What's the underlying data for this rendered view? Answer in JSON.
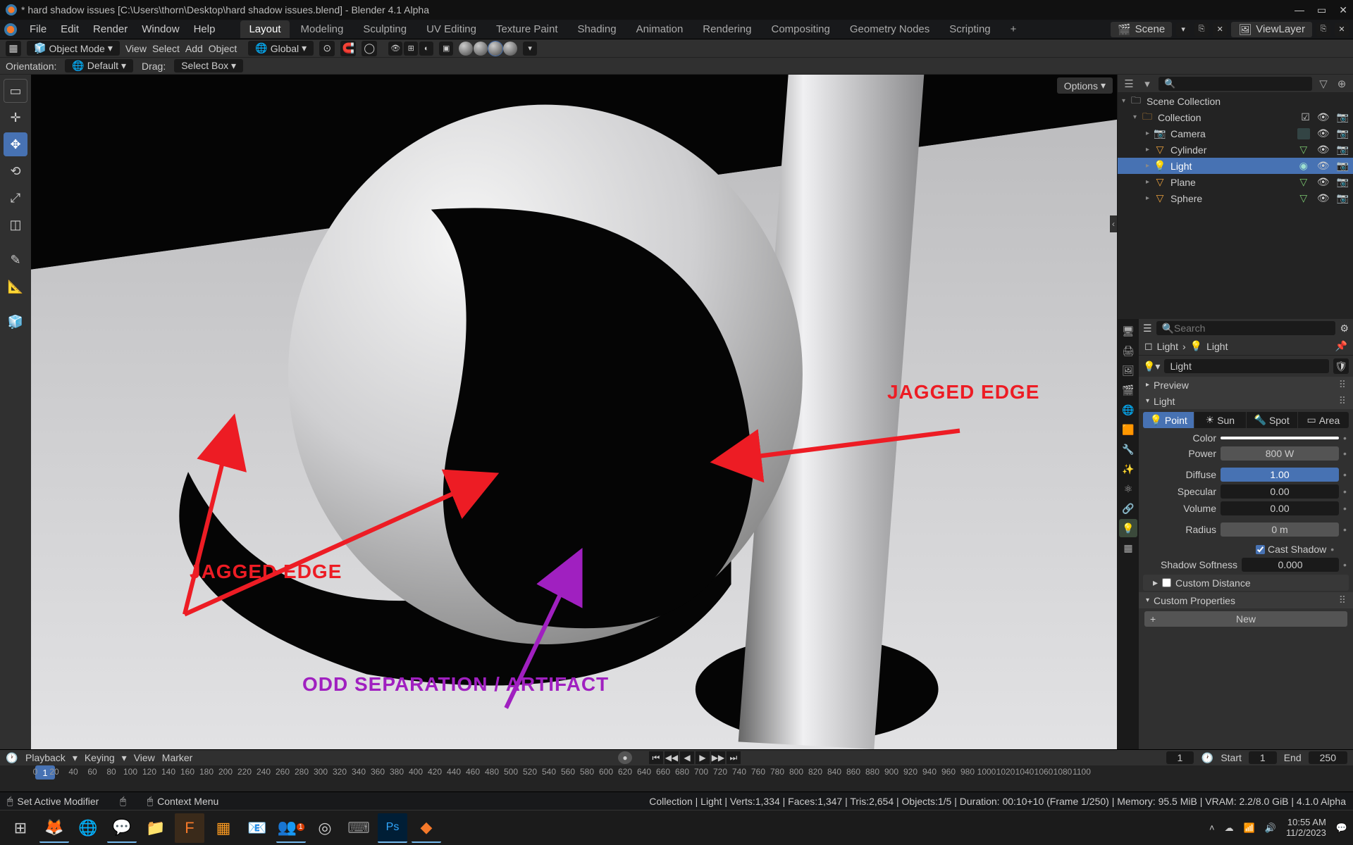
{
  "titlebar": {
    "text": "* hard shadow issues [C:\\Users\\thorn\\Desktop\\hard shadow issues.blend] - Blender 4.1 Alpha"
  },
  "menus": [
    "File",
    "Edit",
    "Render",
    "Window",
    "Help"
  ],
  "workspaces": [
    "Layout",
    "Modeling",
    "Sculpting",
    "UV Editing",
    "Texture Paint",
    "Shading",
    "Animation",
    "Rendering",
    "Compositing",
    "Geometry Nodes",
    "Scripting"
  ],
  "workspace_active": "Layout",
  "scene_label": "Scene",
  "viewlayer_label": "ViewLayer",
  "header2": {
    "mode": "Object Mode",
    "items": [
      "View",
      "Select",
      "Add",
      "Object"
    ],
    "orient": "Global"
  },
  "header3": {
    "orient_lbl": "Orientation:",
    "orient_val": "Default",
    "drag_lbl": "Drag:",
    "drag_val": "Select Box"
  },
  "options_label": "Options",
  "outliner": {
    "search_ph": "",
    "root": "Scene Collection",
    "collection": "Collection",
    "items": [
      "Camera",
      "Cylinder",
      "Light",
      "Plane",
      "Sphere"
    ],
    "selected": "Light"
  },
  "props": {
    "search_ph": "Search",
    "crumb1": "Light",
    "crumb2": "Light",
    "id_field": "Light",
    "preview_hdr": "Preview",
    "light_hdr": "Light",
    "types": [
      "Point",
      "Sun",
      "Spot",
      "Area"
    ],
    "type_active": "Point",
    "color_lbl": "Color",
    "power_lbl": "Power",
    "power_val": "800 W",
    "diffuse_lbl": "Diffuse",
    "diffuse_val": "1.00",
    "specular_lbl": "Specular",
    "specular_val": "0.00",
    "volume_lbl": "Volume",
    "volume_val": "0.00",
    "radius_lbl": "Radius",
    "radius_val": "0 m",
    "cast_shadow": "Cast Shadow",
    "softness_lbl": "Shadow Softness",
    "softness_val": "0.000",
    "custom_dist": "Custom Distance",
    "custom_props": "Custom Properties",
    "new_btn": "New"
  },
  "timeline": {
    "items": [
      "Playback",
      "Keying",
      "View",
      "Marker"
    ],
    "cur": "1",
    "start_lbl": "Start",
    "start": "1",
    "end_lbl": "End",
    "end": "250",
    "ticks": [
      0,
      20,
      40,
      60,
      80,
      100,
      120,
      140,
      160,
      180,
      200,
      220,
      240,
      260,
      280,
      300,
      320,
      340,
      360,
      380,
      400,
      420,
      440,
      460,
      480,
      500,
      520,
      540,
      560,
      580,
      600,
      620,
      640,
      660,
      680,
      700,
      720,
      740,
      760,
      780,
      800,
      820,
      840,
      860,
      880,
      900,
      920,
      940,
      960,
      980,
      1000,
      1020,
      1040,
      1060,
      1080,
      1100
    ]
  },
  "status": {
    "left1": "Set Active Modifier",
    "left2": "Context Menu",
    "right": "Collection | Light | Verts:1,334 | Faces:1,347 | Tris:2,654 | Objects:1/5 | Duration: 00:10+10 (Frame 1/250) | Memory: 95.5 MiB | VRAM: 2.2/8.0 GiB | 4.1.0 Alpha"
  },
  "annotations": {
    "jag1": "JAGGED EDGE",
    "jag2": "JAGGED EDGE",
    "sep": "ODD SEPARATION / ARTIFACT"
  },
  "taskbar": {
    "time": "10:55 AM",
    "date": "11/2/2023"
  }
}
